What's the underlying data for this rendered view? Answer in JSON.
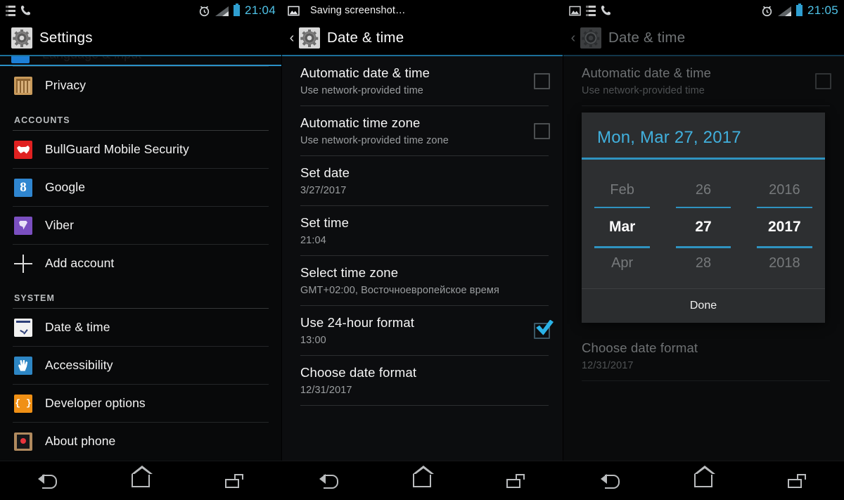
{
  "panels": {
    "left": {
      "statusbar": {
        "icons": [
          "sim-toggle-icon",
          "phone-call-icon"
        ],
        "right_icons": [
          "alarm-clock-icon",
          "signal-icon",
          "battery-icon"
        ],
        "clock": "21:04"
      },
      "actionbar": {
        "title": "Settings",
        "icon": "gear-icon"
      },
      "partial_top_row": {
        "ghost_label": "Language & input"
      },
      "items": [
        {
          "label": "Privacy",
          "icon": "privacy-icon",
          "icon_class": "ic-privacy"
        },
        {
          "label": "BullGuard Mobile Security",
          "icon": "bullguard-icon",
          "icon_class": "ic-bull"
        },
        {
          "label": "Google",
          "icon": "google-icon",
          "icon_class": "ic-google"
        },
        {
          "label": "Viber",
          "icon": "viber-icon",
          "icon_class": "ic-viber"
        },
        {
          "label": "Add account",
          "icon": "plus-icon",
          "icon_class": "ic-plus"
        },
        {
          "label": "Date & time",
          "icon": "clock-icon",
          "icon_class": "ic-datetime"
        },
        {
          "label": "Accessibility",
          "icon": "hand-icon",
          "icon_class": "ic-access"
        },
        {
          "label": "Developer options",
          "icon": "braces-icon",
          "icon_class": "ic-dev"
        },
        {
          "label": "About phone",
          "icon": "phone-info-icon",
          "icon_class": "ic-about"
        }
      ],
      "section_accounts": "ACCOUNTS",
      "section_system": "SYSTEM"
    },
    "middle": {
      "statusbar": {
        "notification_icon": "screenshot-image-icon",
        "notification_text": "Saving screenshot…"
      },
      "actionbar": {
        "title": "Date & time",
        "icon": "gear-icon",
        "up": "‹"
      },
      "prefs": [
        {
          "title": "Automatic date & time",
          "sub": "Use network-provided time",
          "control": "checkbox",
          "checked": false
        },
        {
          "title": "Automatic time zone",
          "sub": "Use network-provided time zone",
          "control": "checkbox",
          "checked": false
        },
        {
          "title": "Set date",
          "sub": "3/27/2017",
          "control": "none"
        },
        {
          "title": "Set time",
          "sub": "21:04",
          "control": "none"
        },
        {
          "title": "Select time zone",
          "sub": "GMT+02:00, Восточноевропейское время",
          "control": "none"
        },
        {
          "title": "Use 24-hour format",
          "sub": "13:00",
          "control": "checkbox",
          "checked": true
        },
        {
          "title": "Choose date format",
          "sub": "12/31/2017",
          "control": "none"
        }
      ]
    },
    "right": {
      "statusbar": {
        "icons": [
          "screenshot-image-icon",
          "sim-toggle-icon",
          "phone-call-icon"
        ],
        "right_icons": [
          "alarm-clock-icon",
          "signal-icon",
          "battery-icon"
        ],
        "clock": "21:05"
      },
      "actionbar": {
        "title": "Date & time",
        "icon": "gear-icon",
        "up": "‹"
      },
      "prefs": [
        {
          "title": "Automatic date & time",
          "sub": "Use network-provided time",
          "control": "checkbox",
          "checked": false
        },
        {
          "title": "Choose date format",
          "sub": "12/31/2017",
          "control": "none"
        }
      ],
      "dialog": {
        "header": "Mon, Mar 27, 2017",
        "done_label": "Done",
        "columns": [
          {
            "name": "month",
            "prev": "Feb",
            "current": "Mar",
            "next": "Apr"
          },
          {
            "name": "day",
            "prev": "26",
            "current": "27",
            "next": "28"
          },
          {
            "name": "year",
            "prev": "2016",
            "current": "2017",
            "next": "2018"
          }
        ]
      }
    }
  },
  "navbar": {
    "buttons": [
      {
        "name": "back-button",
        "icon": "back-arrow-icon"
      },
      {
        "name": "home-button",
        "icon": "home-icon"
      },
      {
        "name": "recents-button",
        "icon": "recents-icon"
      }
    ]
  },
  "colors": {
    "accent": "#33b5e5",
    "accent_dark": "#2b91c7",
    "clock": "#4fc3e8",
    "dialog_bg": "#2b2d2f",
    "text_primary": "#f6f6f6",
    "text_secondary": "#9b9ea0"
  }
}
